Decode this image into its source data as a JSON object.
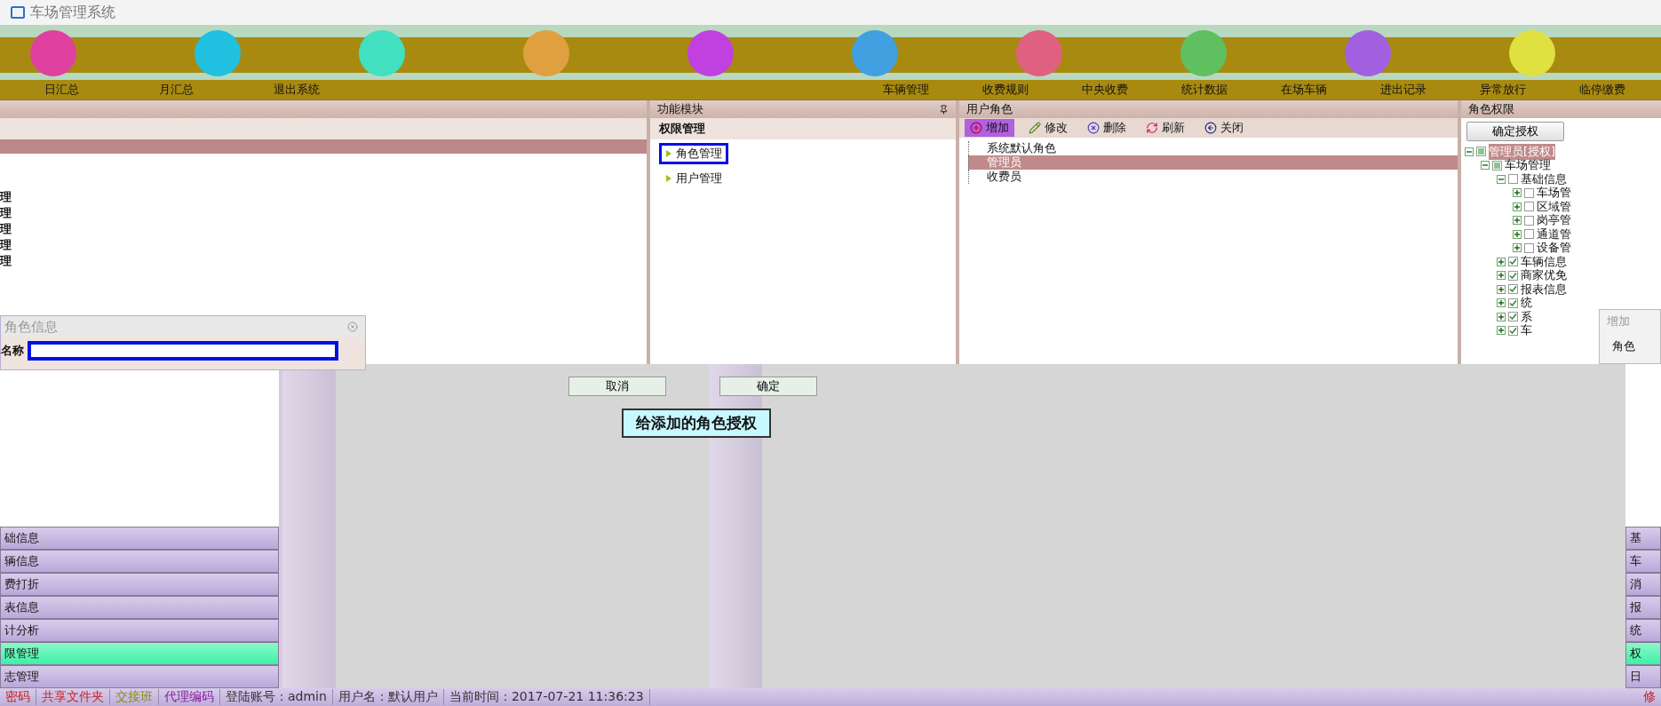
{
  "window": {
    "title": "车场管理系统"
  },
  "top_menu": {
    "left": [
      "日汇总",
      "月汇总",
      "退出系统"
    ],
    "right": [
      "车辆管理",
      "收费规则",
      "中央收费",
      "统计数据",
      "在场车辆",
      "进出记录",
      "异常放行",
      "临停缴费"
    ]
  },
  "main_panel": {
    "rows": [
      "理",
      "理",
      "理",
      "理",
      "理"
    ]
  },
  "role_info_dialog": {
    "title": "角色信息",
    "name_label": "名称"
  },
  "function_module": {
    "title": "功能模块",
    "section": "权限管理",
    "items": [
      {
        "label": "角色管理",
        "selected": true
      },
      {
        "label": "用户管理",
        "selected": false
      }
    ]
  },
  "user_roles": {
    "title": "用户角色",
    "toolbar": [
      {
        "label": "增加",
        "kind": "add",
        "selected": true
      },
      {
        "label": "修改",
        "kind": "edit",
        "selected": false
      },
      {
        "label": "删除",
        "kind": "delete",
        "selected": false
      },
      {
        "label": "刷新",
        "kind": "refresh",
        "selected": false
      },
      {
        "label": "关闭",
        "kind": "close",
        "selected": false
      }
    ],
    "roles": [
      {
        "label": "系统默认角色",
        "selected": false
      },
      {
        "label": "管理员",
        "selected": true
      },
      {
        "label": "收费员",
        "selected": false
      }
    ]
  },
  "role_permissions": {
    "title": "角色权限",
    "button": "确定授权",
    "tree": [
      {
        "label": "管理员[授权]",
        "checked": false,
        "partial": true,
        "expanded": true,
        "selected": true,
        "children": [
          {
            "label": "车场管理",
            "checked": false,
            "partial": true,
            "expanded": true,
            "selected": false,
            "children": [
              {
                "label": "基础信息",
                "checked": false,
                "expanded": true,
                "selected": false,
                "children": [
                  {
                    "label": "车场管",
                    "checked": false,
                    "expanded": false,
                    "selected": false
                  },
                  {
                    "label": "区域管",
                    "checked": false,
                    "expanded": false,
                    "selected": false
                  },
                  {
                    "label": "岗亭管",
                    "checked": false,
                    "expanded": false,
                    "selected": false
                  },
                  {
                    "label": "通道管",
                    "checked": false,
                    "expanded": false,
                    "selected": false
                  },
                  {
                    "label": "设备管",
                    "checked": false,
                    "expanded": false,
                    "selected": false
                  }
                ]
              },
              {
                "label": "车辆信息",
                "checked": true,
                "expanded": false,
                "selected": false
              },
              {
                "label": "商家优免",
                "checked": true,
                "expanded": false,
                "selected": false
              },
              {
                "label": "报表信息",
                "checked": true,
                "expanded": false,
                "selected": false
              },
              {
                "label": "统",
                "checked": true,
                "expanded": false,
                "selected": false
              },
              {
                "label": "系",
                "checked": true,
                "expanded": false,
                "selected": false
              },
              {
                "label": "车",
                "checked": true,
                "expanded": false,
                "selected": false
              }
            ]
          }
        ]
      }
    ]
  },
  "add_role_dialog": {
    "title": "增加",
    "field_label": "角色"
  },
  "dialog_buttons": [
    "取消",
    "确定"
  ],
  "tooltip": "给添加的角色授权",
  "left_nav": [
    {
      "label": "础信息",
      "selected": false
    },
    {
      "label": "辆信息",
      "selected": false
    },
    {
      "label": "费打折",
      "selected": false
    },
    {
      "label": "表信息",
      "selected": false
    },
    {
      "label": "计分析",
      "selected": false
    },
    {
      "label": "限管理",
      "selected": true
    },
    {
      "label": "志管理",
      "selected": false
    }
  ],
  "right_nav": [
    {
      "label": "基",
      "selected": false
    },
    {
      "label": "车",
      "selected": false
    },
    {
      "label": "消",
      "selected": false
    },
    {
      "label": "报",
      "selected": false
    },
    {
      "label": "统",
      "selected": false
    },
    {
      "label": "权",
      "selected": true
    },
    {
      "label": "日",
      "selected": false
    }
  ],
  "status_bar": {
    "items": [
      {
        "text": "密码",
        "color": "#c02020"
      },
      {
        "text": "共享文件夹",
        "color": "#d02020"
      },
      {
        "text": "交接班",
        "color": "#8a8a10"
      },
      {
        "text": "代理编码",
        "color": "#8a1a9a"
      },
      {
        "text": "登陆账号：admin",
        "color": "#333333"
      },
      {
        "text": "用户名：默认用户",
        "color": "#333333"
      },
      {
        "text": "当前时间：2017-07-21 11:36:23",
        "color": "#333333"
      }
    ],
    "right": "修"
  }
}
